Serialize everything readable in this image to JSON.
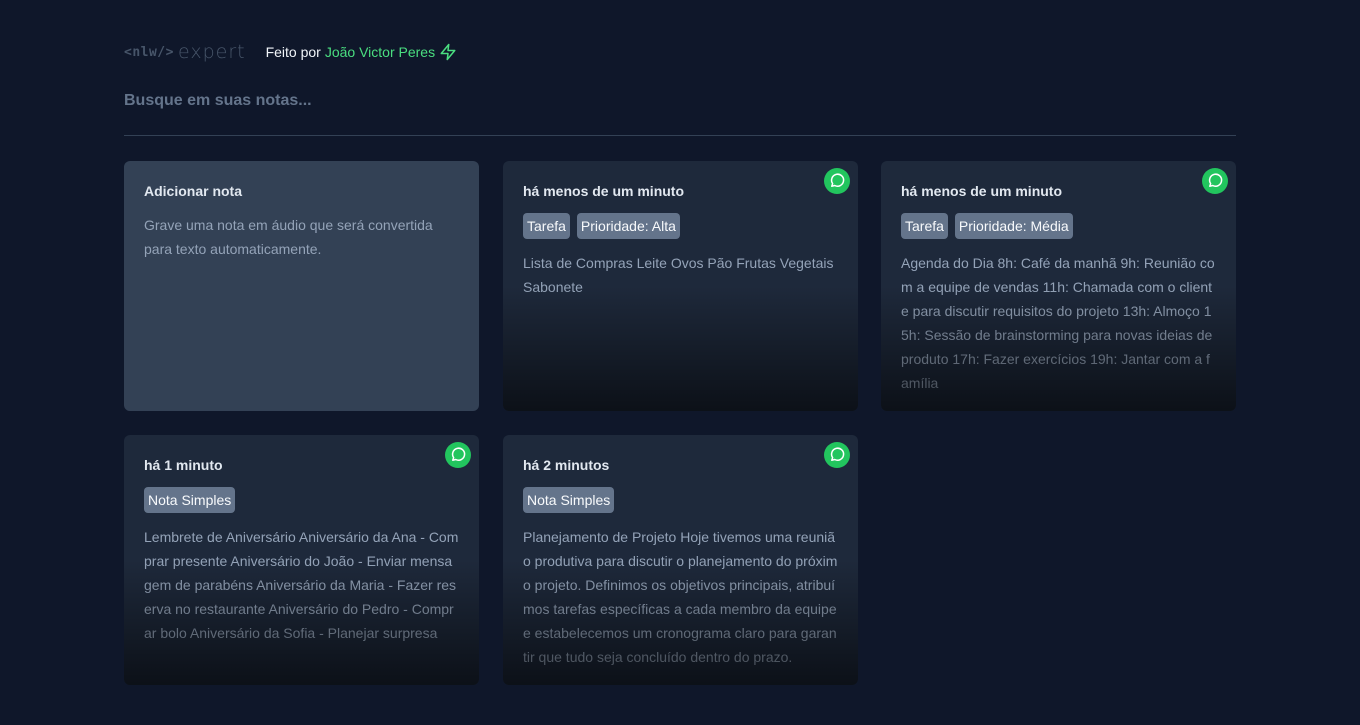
{
  "header": {
    "logo_prefix": "<nlw/>",
    "logo_word": "expert",
    "byline_prefix": "Feito por",
    "author": "João Victor Peres"
  },
  "search": {
    "placeholder": "Busque em suas notas..."
  },
  "add_card": {
    "title": "Adicionar nota",
    "description": "Grave uma nota em áudio que será convertida para texto automaticamente."
  },
  "notes": [
    {
      "time": "há menos de um minuto",
      "tags": [
        "Tarefa",
        "Prioridade: Alta"
      ],
      "content": "Lista de Compras Leite Ovos Pão Frutas Vegetais Sabonete"
    },
    {
      "time": "há menos de um minuto",
      "tags": [
        "Tarefa",
        "Prioridade: Média"
      ],
      "content": "Agenda do Dia 8h: Café da manhã 9h: Reunião com a equipe de vendas 11h: Chamada com o cliente para discutir requisitos do projeto 13h: Almoço 15h: Sessão de brainstorming para novas ideias de produto 17h: Fazer exercícios 19h: Jantar com a família"
    },
    {
      "time": "há 1 minuto",
      "tags": [
        "Nota Simples"
      ],
      "content": "Lembrete de Aniversário Aniversário da Ana - Comprar presente Aniversário do João - Enviar mensagem de parabéns Aniversário da Maria - Fazer reserva no restaurante Aniversário do Pedro - Comprar bolo Aniversário da Sofia - Planejar surpresa"
    },
    {
      "time": "há 2 minutos",
      "tags": [
        "Nota Simples"
      ],
      "content": "Planejamento de Projeto Hoje tivemos uma reunião produtiva para discutir o planejamento do próximo projeto. Definimos os objetivos principais, atribuímos tarefas específicas a cada membro da equipe e estabelecemos um cronograma claro para garantir que tudo seja concluído dentro do prazo."
    }
  ],
  "colors": {
    "background": "#0f172a",
    "card": "#1e293b",
    "add_card": "#334155",
    "accent": "#4ade80",
    "whatsapp": "#22c55e",
    "tag": "#64748b"
  },
  "icons": {
    "bolt": "bolt-icon",
    "whatsapp": "whatsapp-icon"
  }
}
